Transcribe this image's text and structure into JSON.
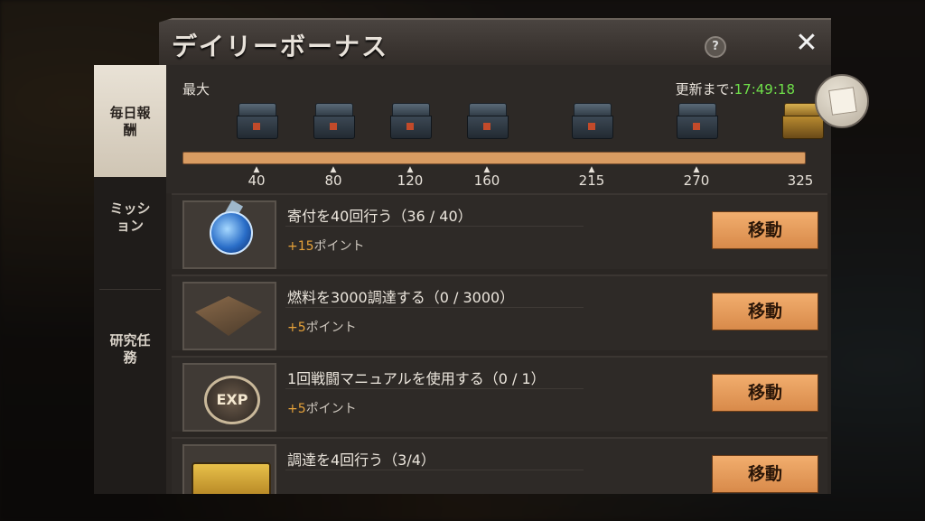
{
  "dialog": {
    "title": "デイリーボーナス",
    "help_icon": "?",
    "close_icon": "✕"
  },
  "sidebar": {
    "tabs": [
      {
        "label": "毎日報酬",
        "active": true
      },
      {
        "label": "ミッション",
        "active": false
      },
      {
        "label": "研究任務",
        "active": false
      }
    ]
  },
  "progress": {
    "max_label": "最大",
    "refresh_label": "更新まで:",
    "refresh_time": "17:49:18",
    "milestones": [
      "40",
      "80",
      "120",
      "160",
      "215",
      "270",
      "325"
    ],
    "current_points": 325
  },
  "tasks": [
    {
      "name": "寄付を40回行う（36 / 40）",
      "points": "+15",
      "points_suffix": "ポイント",
      "button": "移動",
      "icon": "potion-flask-icon"
    },
    {
      "name": "燃料を3000調達する（0 / 3000）",
      "points": "+5",
      "points_suffix": "ポイント",
      "button": "移動",
      "icon": "refinery-building-icon"
    },
    {
      "name": "1回戦闘マニュアルを使用する（0 / 1）",
      "points": "+5",
      "points_suffix": "ポイント",
      "button": "移動",
      "icon": "exp-badge-icon"
    },
    {
      "name": "調達を4回行う（3/4）",
      "points": "",
      "points_suffix": "",
      "button": "移動",
      "icon": "supply-truck-icon"
    }
  ],
  "colors": {
    "accent_orange": "#e6a23a",
    "timer_green": "#6fe04a",
    "button_orange": "#f2ae6e"
  }
}
